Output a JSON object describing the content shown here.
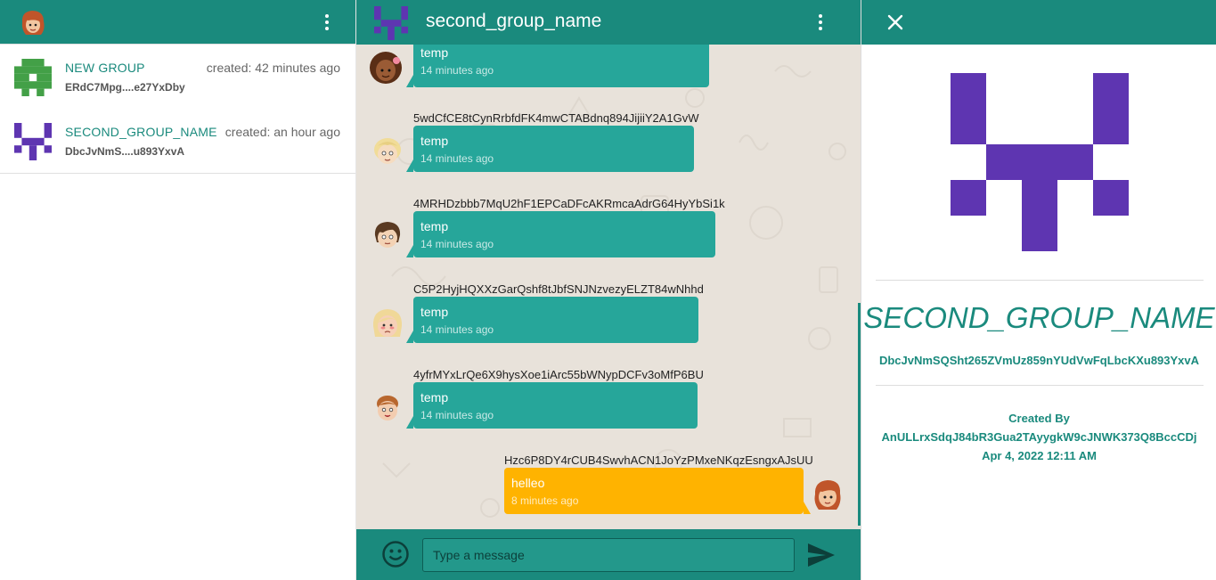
{
  "colors": {
    "primary": "#1a8a7d",
    "bubble_in": "#26a69a",
    "bubble_out": "#ffb300",
    "chat_bg": "#e8e2da",
    "identicon_purple": "#5e35b1",
    "identicon_green": "#43a047"
  },
  "left": {
    "header": {
      "avatar": "user-avatar-cartoon",
      "menu_icon": "more-vert-icon"
    },
    "groups": [
      {
        "name": "NEW GROUP",
        "id_short": "ERdC7Mpg....e27YxDby",
        "created": "created: 42 minutes ago",
        "icon": "identicon-green"
      },
      {
        "name": "SECOND_GROUP_NAME",
        "id_short": "DbcJvNmS....u893YxvA",
        "created": "created: an hour ago",
        "icon": "identicon-purple"
      }
    ]
  },
  "chat": {
    "title": "second_group_name",
    "menu_icon": "more-vert-icon",
    "messages": [
      {
        "sender": "",
        "text": "temp",
        "time": "14 minutes ago",
        "mine": false
      },
      {
        "sender": "5wdCfCE8tCynRrbfdFK4mwCTABdnq894JijiiY2A1GvW",
        "text": "temp",
        "time": "14 minutes ago",
        "mine": false
      },
      {
        "sender": "4MRHDzbbb7MqU2hF1EPCaDFcAKRmcaAdrG64HyYbSi1k",
        "text": "temp",
        "time": "14 minutes ago",
        "mine": false
      },
      {
        "sender": "C5P2HyjHQXXzGarQshf8tJbfSNJNzvezyELZT84wNhhd",
        "text": "temp",
        "time": "14 minutes ago",
        "mine": false
      },
      {
        "sender": "4yfrMYxLrQe6X9hysXoe1iArc55bWNypDCFv3oMfP6BU",
        "text": "temp",
        "time": "14 minutes ago",
        "mine": false
      },
      {
        "sender": "Hzc6P8DY4rCUB4SwvhACN1JoYzPMxeNKqzEsngxAJsUU",
        "text": "helleo",
        "time": "8 minutes ago",
        "mine": true
      }
    ],
    "composer": {
      "placeholder": "Type a message",
      "emoji_icon": "emoji-smile-icon",
      "send_icon": "send-icon"
    }
  },
  "info": {
    "close_icon": "close-icon",
    "name": "SECOND_GROUP_NAME",
    "id": "DbcJvNmSQSht265ZVmUz859nYUdVwFqLbcKXu893YxvA",
    "created_by_label": "Created By",
    "created_by": "AnULLrxSdqJ84bR3Gua2TAyygkW9cJNWK373Q8BccCDj",
    "created_at": "Apr 4, 2022 12:11 AM"
  }
}
